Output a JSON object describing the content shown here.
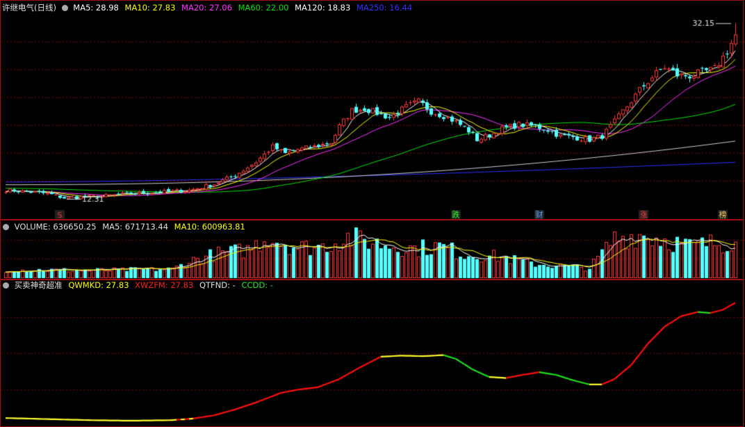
{
  "colors": {
    "bg": "#000000",
    "up": "#ff3b3b",
    "down": "#54ffff",
    "grid": "#7a0000",
    "ma5": "#ffffff",
    "ma10": "#ffff00",
    "ma20": "#ff33ff",
    "ma60": "#00e000",
    "ma120": "#d0d0d0",
    "ma250": "#3030ff",
    "ind_red": "#ff1010",
    "ind_green": "#20e020",
    "ind_yellow": "#ffff30",
    "label": "#e0e0e0"
  },
  "main": {
    "stock_name": "许继电气(日线)",
    "ma_labels": [
      {
        "text": "MA5: 28.98",
        "color": "#ffffff"
      },
      {
        "text": "MA10: 27.83",
        "color": "#ffff00"
      },
      {
        "text": "MA20: 27.06",
        "color": "#ff33ff"
      },
      {
        "text": "MA60: 22.00",
        "color": "#00e000"
      },
      {
        "text": "MA120: 18.83",
        "color": "#ffffff"
      },
      {
        "text": "MA250: 16.44",
        "color": "#3333ff"
      }
    ],
    "high_label": "32.15",
    "low_label": "12.31",
    "event_markers": [
      {
        "text": "S",
        "index": 13,
        "color": "#ff3030"
      },
      {
        "text": "跌",
        "index": 108,
        "color": "#33ff33"
      },
      {
        "text": "财",
        "index": 128,
        "color": "#66aaff"
      },
      {
        "text": "涨",
        "index": 153,
        "color": "#ff4040"
      },
      {
        "text": "榜",
        "index": 172,
        "color": "#ffcc66"
      }
    ]
  },
  "volume": {
    "labels": [
      {
        "text": "VOLUME: 636650.25",
        "color": "#e0e0e0"
      },
      {
        "text": "MA5: 671713.44",
        "color": "#e0e0e0"
      },
      {
        "text": "MA10: 600963.81",
        "color": "#ffff00"
      }
    ]
  },
  "indicator": {
    "labels": [
      {
        "text": "买卖神奇超准",
        "color": "#e0e0e0"
      },
      {
        "text": "QWMKD: 27.83",
        "color": "#ffff00"
      },
      {
        "text": "XWZFM: 27.83",
        "color": "#ff2020"
      },
      {
        "text": "QTFND: -",
        "color": "#e0e0e0"
      },
      {
        "text": "CCDD: -",
        "color": "#30e030"
      }
    ]
  },
  "chart_data": {
    "type": "candlestick",
    "title": "许继电气(日线)",
    "y_range": [
      12.31,
      32.15
    ],
    "grid": true,
    "close_anchors": [
      [
        0,
        13.3
      ],
      [
        10,
        12.9
      ],
      [
        14,
        12.4
      ],
      [
        22,
        12.6
      ],
      [
        30,
        12.9
      ],
      [
        38,
        13.1
      ],
      [
        44,
        13.3
      ],
      [
        50,
        14.0
      ],
      [
        55,
        15.0
      ],
      [
        60,
        16.5
      ],
      [
        64,
        18.2
      ],
      [
        67,
        17.4
      ],
      [
        70,
        17.9
      ],
      [
        74,
        18.2
      ],
      [
        78,
        18.7
      ],
      [
        80,
        20.5
      ],
      [
        83,
        22.3
      ],
      [
        86,
        22.5
      ],
      [
        89,
        22.0
      ],
      [
        92,
        21.5
      ],
      [
        96,
        22.7
      ],
      [
        99,
        23.3
      ],
      [
        102,
        22.2
      ],
      [
        105,
        21.7
      ],
      [
        108,
        21.0
      ],
      [
        111,
        20.0
      ],
      [
        113,
        19.0
      ],
      [
        116,
        19.5
      ],
      [
        119,
        20.2
      ],
      [
        123,
        20.7
      ],
      [
        127,
        20.5
      ],
      [
        130,
        20.1
      ],
      [
        133,
        19.4
      ],
      [
        136,
        19.3
      ],
      [
        140,
        19.0
      ],
      [
        143,
        19.4
      ],
      [
        146,
        21.0
      ],
      [
        149,
        22.8
      ],
      [
        152,
        24.6
      ],
      [
        155,
        26.1
      ],
      [
        158,
        27.2
      ],
      [
        161,
        26.3
      ],
      [
        164,
        26.2
      ],
      [
        167,
        26.6
      ],
      [
        170,
        27.0
      ],
      [
        173,
        29.0
      ],
      [
        175,
        30.8
      ]
    ],
    "ma_end_values": {
      "MA5": 28.98,
      "MA10": 27.83,
      "MA20": 27.06,
      "MA60": 22.0,
      "MA120": 18.83,
      "MA250": 16.44
    },
    "volume_anchors": [
      [
        0,
        150000
      ],
      [
        20,
        140000
      ],
      [
        40,
        160000
      ],
      [
        44,
        300000
      ],
      [
        50,
        420000
      ],
      [
        58,
        500000
      ],
      [
        63,
        720000
      ],
      [
        70,
        540000
      ],
      [
        76,
        560000
      ],
      [
        82,
        720000
      ],
      [
        90,
        600000
      ],
      [
        98,
        520000
      ],
      [
        104,
        560000
      ],
      [
        110,
        420000
      ],
      [
        118,
        380000
      ],
      [
        126,
        260000
      ],
      [
        132,
        220000
      ],
      [
        140,
        180000
      ],
      [
        146,
        700000
      ],
      [
        152,
        760000
      ],
      [
        158,
        680000
      ],
      [
        164,
        560000
      ],
      [
        170,
        620000
      ],
      [
        175,
        636650
      ]
    ],
    "volume_ma": {
      "MA5": 671713.44,
      "MA10": 600963.81
    },
    "indicator_series": {
      "name": "XWZFM",
      "anchors": [
        [
          0,
          9
        ],
        [
          20,
          5
        ],
        [
          30,
          4
        ],
        [
          40,
          5
        ],
        [
          45,
          8
        ],
        [
          50,
          14
        ],
        [
          55,
          25
        ],
        [
          60,
          38
        ],
        [
          66,
          56
        ],
        [
          70,
          62
        ],
        [
          75,
          67
        ],
        [
          80,
          82
        ],
        [
          85,
          104
        ],
        [
          90,
          124
        ],
        [
          95,
          126
        ],
        [
          100,
          125
        ],
        [
          105,
          127
        ],
        [
          108,
          120
        ],
        [
          112,
          100
        ],
        [
          116,
          86
        ],
        [
          120,
          84
        ],
        [
          124,
          90
        ],
        [
          128,
          95
        ],
        [
          132,
          90
        ],
        [
          136,
          80
        ],
        [
          140,
          72
        ],
        [
          143,
          72
        ],
        [
          146,
          82
        ],
        [
          150,
          108
        ],
        [
          154,
          148
        ],
        [
          158,
          180
        ],
        [
          162,
          200
        ],
        [
          166,
          208
        ],
        [
          169,
          206
        ],
        [
          172,
          212
        ],
        [
          175,
          225
        ]
      ],
      "last_value": 27.83
    }
  }
}
